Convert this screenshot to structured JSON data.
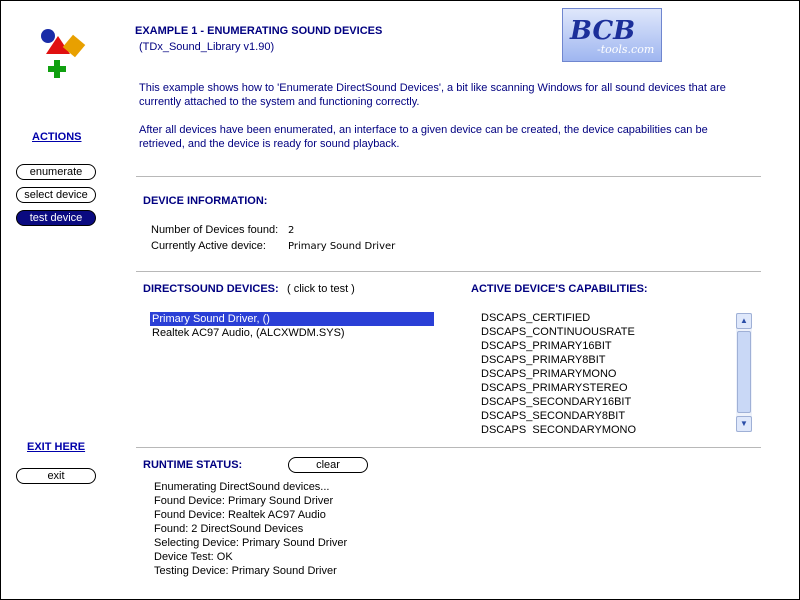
{
  "header": {
    "title": "EXAMPLE 1 - ENUMERATING SOUND DEVICES",
    "subtitle": "(TDx_Sound_Library v1.90)",
    "logo_text": "BCB-Tools.com"
  },
  "intro": {
    "para1_line1": "This example shows how to 'Enumerate DirectSound Devices', a bit like scanning Windows for all sound devices that are",
    "para1_line2": "currently attached to the system and functioning correctly.",
    "para2_line1": "After all devices have been enumerated, an interface to a given device can be created, the device capabilities can be",
    "para2_line2": "retrieved, and the device is ready for sound playback."
  },
  "sidebar": {
    "actions_label": "ACTIONS",
    "buttons": [
      {
        "label": "enumerate"
      },
      {
        "label": "select device"
      },
      {
        "label": "test device"
      }
    ],
    "exit_label": "EXIT HERE",
    "exit_button": "exit"
  },
  "device_info": {
    "heading": "DEVICE INFORMATION:",
    "count_label": "Number of Devices found:",
    "count_value": "2",
    "active_label": "Currently Active device:",
    "active_value": "Primary Sound Driver"
  },
  "devices": {
    "heading": "DIRECTSOUND DEVICES:",
    "hint": "( click to test )",
    "items": [
      {
        "label": "Primary Sound Driver, ()"
      },
      {
        "label": "Realtek AC97 Audio, (ALCXWDM.SYS)"
      }
    ]
  },
  "capabilities": {
    "heading": "ACTIVE DEVICE'S CAPABILITIES:",
    "items": [
      "DSCAPS_CERTIFIED",
      "DSCAPS_CONTINUOUSRATE",
      "DSCAPS_PRIMARY16BIT",
      "DSCAPS_PRIMARY8BIT",
      "DSCAPS_PRIMARYMONO",
      "DSCAPS_PRIMARYSTEREO",
      "DSCAPS_SECONDARY16BIT",
      "DSCAPS_SECONDARY8BIT",
      "DSCAPS_SECONDARYMONO"
    ]
  },
  "runtime": {
    "heading": "RUNTIME STATUS:",
    "clear_button": "clear",
    "lines": [
      "Enumerating DirectSound devices...",
      "Found Device: Primary Sound Driver",
      "Found Device: Realtek AC97 Audio",
      "Found: 2 DirectSound Devices",
      "Selecting Device: Primary Sound Driver",
      "Device Test: OK",
      "Testing Device: Primary Sound Driver"
    ]
  },
  "icons": {
    "app_logo": "shapes-logo-icon",
    "scroll_up": "scroll-up-arrow-icon",
    "scroll_down": "scroll-down-arrow-icon"
  },
  "colors": {
    "heading": "#000080",
    "active_button": "#0a0a80",
    "selection": "#2a3fd6",
    "link": "#0000aa"
  }
}
